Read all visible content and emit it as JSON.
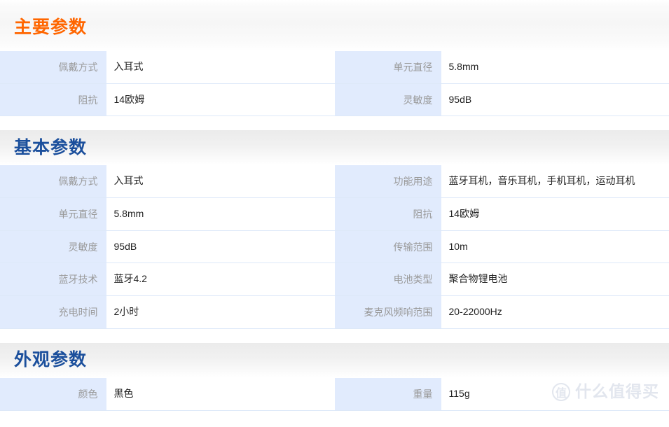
{
  "sections": [
    {
      "title": "主要参数",
      "title_color": "#ff6600",
      "rows": [
        {
          "k1": "佩戴方式",
          "v1": "入耳式",
          "k2": "单元直径",
          "v2": "5.8mm"
        },
        {
          "k1": "阻抗",
          "v1": "14欧姆",
          "k2": "灵敏度",
          "v2": "95dB"
        }
      ]
    },
    {
      "title": "基本参数",
      "title_color": "#1b4f9c",
      "rows": [
        {
          "k1": "佩戴方式",
          "v1": "入耳式",
          "k2": "功能用途",
          "v2": "蓝牙耳机，音乐耳机，手机耳机，运动耳机"
        },
        {
          "k1": "单元直径",
          "v1": "5.8mm",
          "k2": "阻抗",
          "v2": "14欧姆"
        },
        {
          "k1": "灵敏度",
          "v1": "95dB",
          "k2": "传输范围",
          "v2": "10m"
        },
        {
          "k1": "蓝牙技术",
          "v1": "蓝牙4.2",
          "k2": "电池类型",
          "v2": "聚合物锂电池"
        },
        {
          "k1": "充电时间",
          "v1": "2小时",
          "k2": "麦克风频响范围",
          "v2": "20-22000Hz"
        }
      ]
    },
    {
      "title": "外观参数",
      "title_color": "#1b4f9c",
      "rows": [
        {
          "k1": "颜色",
          "v1": "黑色",
          "k2": "重量",
          "v2": "115g"
        }
      ]
    }
  ],
  "watermark": {
    "badge": "值",
    "text": "什么值得买",
    "color": "#e2e6ee"
  }
}
